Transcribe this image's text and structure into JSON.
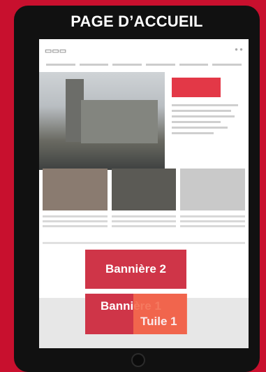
{
  "header": {
    "title": "PAGE D’ACCUEIL"
  },
  "overlays": {
    "banner2": "Bannière 2",
    "banner1": "Bannière 1",
    "tile1": "Tuile 1"
  },
  "colors": {
    "background": "#c8102e",
    "banner": "#cf3548",
    "tile": "#f56b4e",
    "tablet": "#111111"
  }
}
